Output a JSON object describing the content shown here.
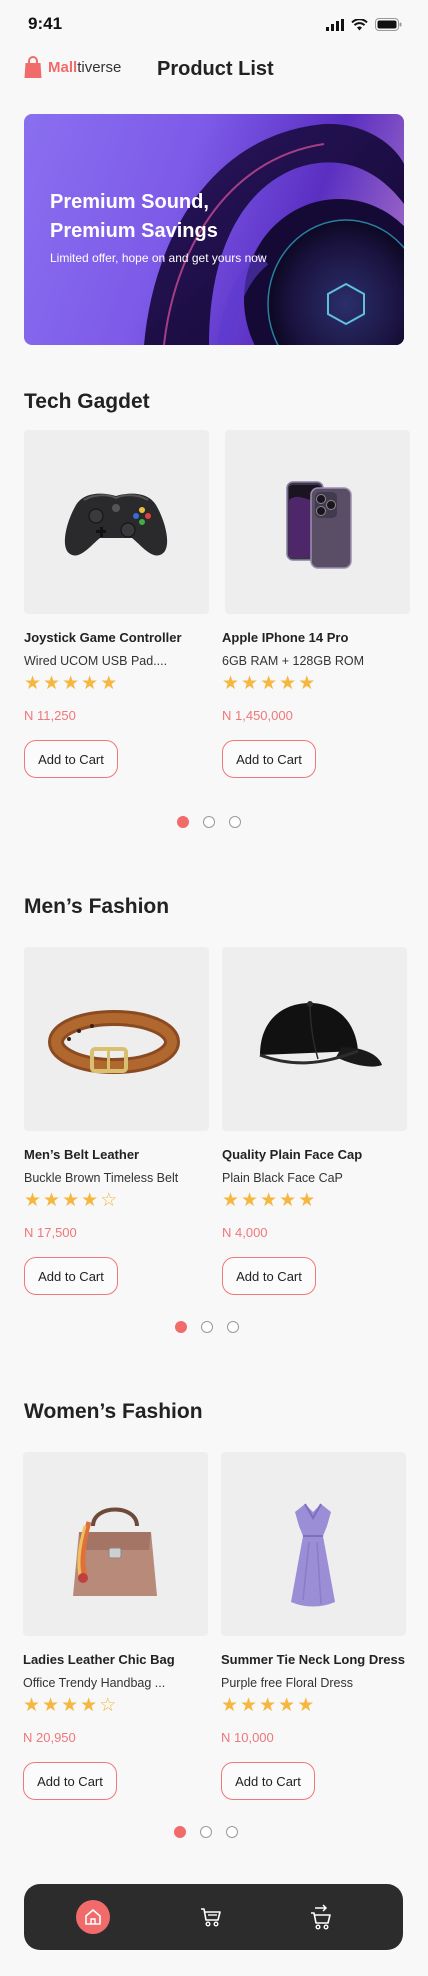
{
  "status": {
    "time": "9:41"
  },
  "header": {
    "logo_part1": "Mall",
    "logo_part2": "tiverse",
    "title": "Product List"
  },
  "banner": {
    "title": "Premium Sound, Premium Savings",
    "subtitle": "Limited offer, hope on and get yours now"
  },
  "sections": [
    {
      "title": "Tech Gagdet",
      "products": [
        {
          "name": "Joystick Game Controller",
          "desc": "Wired UCOM USB Pad....",
          "rating": 5,
          "price": "N 11,250",
          "button": "Add to Cart",
          "icon": "gamepad-icon"
        },
        {
          "name": "Apple IPhone 14 Pro",
          "desc": "6GB RAM + 128GB ROM",
          "rating": 5,
          "price": "N 1,450,000",
          "button": "Add to Cart",
          "icon": "smartphone-icon"
        }
      ],
      "pager": {
        "count": 3,
        "active": 0
      }
    },
    {
      "title": "Men’s Fashion",
      "products": [
        {
          "name": "Men’s Belt Leather",
          "desc": "Buckle Brown Timeless Belt",
          "rating": 4,
          "price": "N 17,500",
          "button": "Add to Cart",
          "icon": "belt-icon"
        },
        {
          "name": "Quality Plain Face Cap",
          "desc": "Plain Black Face CaP",
          "rating": 5,
          "price": "N 4,000",
          "button": "Add to Cart",
          "icon": "cap-icon"
        }
      ],
      "pager": {
        "count": 3,
        "active": 0
      }
    },
    {
      "title": "Women’s Fashion",
      "products": [
        {
          "name": "Ladies Leather Chic Bag",
          "desc": "Office Trendy Handbag ...",
          "rating": 4,
          "price": "N 20,950",
          "button": "Add to Cart",
          "icon": "handbag-icon"
        },
        {
          "name": "Summer Tie Neck Long Dress",
          "desc": "Purple free Floral Dress",
          "rating": 5,
          "price": "N 10,000",
          "button": "Add to Cart",
          "icon": "dress-icon"
        }
      ],
      "pager": {
        "count": 3,
        "active": 0
      }
    }
  ],
  "nav": [
    {
      "icon": "home-icon",
      "active": true
    },
    {
      "icon": "cart-icon",
      "active": false
    },
    {
      "icon": "checkout-cart-icon",
      "active": false
    }
  ],
  "colors": {
    "accent": "#f26b6b",
    "star": "#f6b740",
    "price": "#f0777a",
    "nav_bg": "#2c2c2c"
  }
}
